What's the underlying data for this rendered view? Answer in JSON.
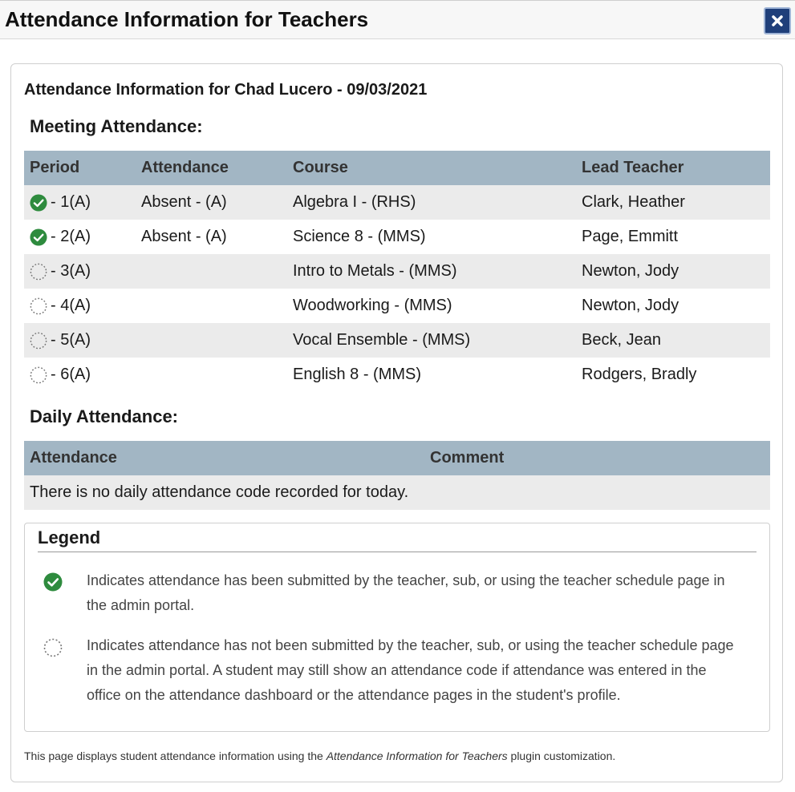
{
  "window": {
    "title": "Attendance Information for Teachers",
    "close_label": "close"
  },
  "student_heading": "Attendance Information for Chad Lucero - 09/03/2021",
  "meeting": {
    "heading": "Meeting Attendance:",
    "columns": [
      "Period",
      "Attendance",
      "Course",
      "Lead Teacher"
    ],
    "rows": [
      {
        "status_icon": "check-circle-icon",
        "period": "- 1(A)",
        "attendance": "Absent - (A)",
        "course": "Algebra I - (RHS)",
        "teacher": "Clark, Heather"
      },
      {
        "status_icon": "check-circle-icon",
        "period": "- 2(A)",
        "attendance": "Absent - (A)",
        "course": "Science 8 - (MMS)",
        "teacher": "Page, Emmitt"
      },
      {
        "status_icon": "dotted-circle-icon",
        "period": "- 3(A)",
        "attendance": "",
        "course": "Intro to Metals - (MMS)",
        "teacher": "Newton, Jody"
      },
      {
        "status_icon": "dotted-circle-icon",
        "period": "- 4(A)",
        "attendance": "",
        "course": "Woodworking - (MMS)",
        "teacher": "Newton, Jody"
      },
      {
        "status_icon": "dotted-circle-icon",
        "period": "- 5(A)",
        "attendance": "",
        "course": "Vocal Ensemble - (MMS)",
        "teacher": "Beck, Jean"
      },
      {
        "status_icon": "dotted-circle-icon",
        "period": "- 6(A)",
        "attendance": "",
        "course": "English 8 - (MMS)",
        "teacher": "Rodgers, Bradly"
      }
    ]
  },
  "daily": {
    "heading": "Daily Attendance:",
    "columns": [
      "Attendance",
      "Comment"
    ],
    "empty_message": "There is no daily attendance code recorded for today."
  },
  "legend": {
    "title": "Legend",
    "items": [
      {
        "icon": "check-circle-icon",
        "text": "Indicates attendance has been submitted by the teacher, sub, or using the teacher schedule page in the admin portal."
      },
      {
        "icon": "dotted-circle-icon",
        "text": "Indicates attendance has not been submitted by the teacher, sub, or using the teacher schedule page in the admin portal. A student may still show an attendance code if attendance was entered in the office on the attendance dashboard or the attendance pages in the student's profile."
      }
    ]
  },
  "footer": {
    "prefix": "This page displays student attendance information using the ",
    "plugin_name": "Attendance Information for Teachers",
    "suffix": " plugin customization."
  },
  "colors": {
    "header_row": "#a2b6c4",
    "odd_row": "#ebebeb",
    "check_green": "#2e8b3e",
    "close_button": "#1f3f7a"
  }
}
